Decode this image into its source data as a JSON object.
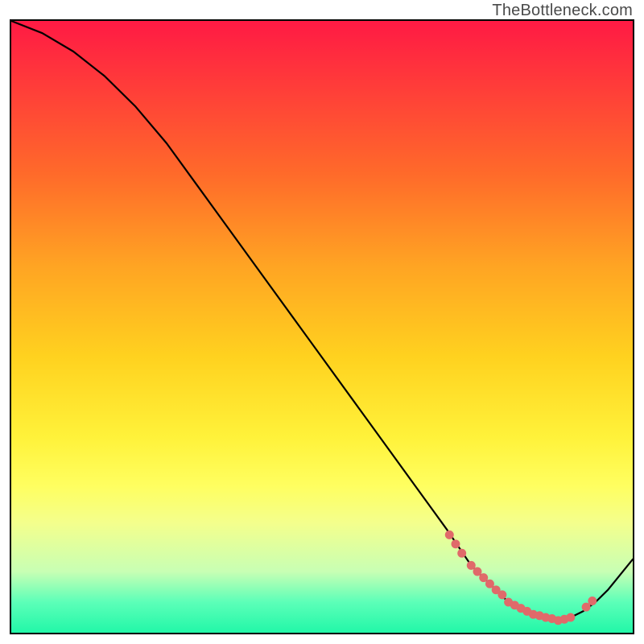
{
  "attribution": "TheBottleneck.com",
  "chart_data": {
    "type": "line",
    "title": "",
    "xlabel": "",
    "ylabel": "",
    "xlim": [
      0,
      100
    ],
    "ylim": [
      0,
      100
    ],
    "grid": false,
    "series": [
      {
        "name": "bottleneck-curve",
        "x": [
          0,
          5,
          10,
          15,
          20,
          25,
          30,
          35,
          40,
          45,
          50,
          55,
          60,
          65,
          70,
          74,
          76,
          78,
          80,
          82,
          84,
          86,
          88,
          90,
          92,
          94,
          96,
          98,
          100
        ],
        "y": [
          100,
          98,
          95,
          91,
          86,
          80,
          73,
          66,
          59,
          52,
          45,
          38,
          31,
          24,
          17,
          11,
          9,
          7,
          5,
          4,
          3,
          2.5,
          2,
          2.5,
          3.5,
          5,
          7,
          9.5,
          12
        ]
      }
    ],
    "markers": {
      "name": "highlight-dots",
      "color": "#e06a6a",
      "x": [
        70.5,
        71.5,
        72.5,
        74,
        75,
        76,
        77,
        78,
        79,
        80,
        81,
        82,
        83,
        84,
        85,
        86,
        87,
        88,
        89,
        90,
        92.5,
        93.5
      ],
      "y": [
        16.0,
        14.5,
        13.0,
        11.0,
        10.0,
        9.0,
        8.0,
        7.0,
        6.2,
        5.0,
        4.5,
        4.0,
        3.5,
        3.0,
        2.8,
        2.5,
        2.3,
        2.0,
        2.2,
        2.5,
        4.2,
        5.2
      ]
    }
  }
}
